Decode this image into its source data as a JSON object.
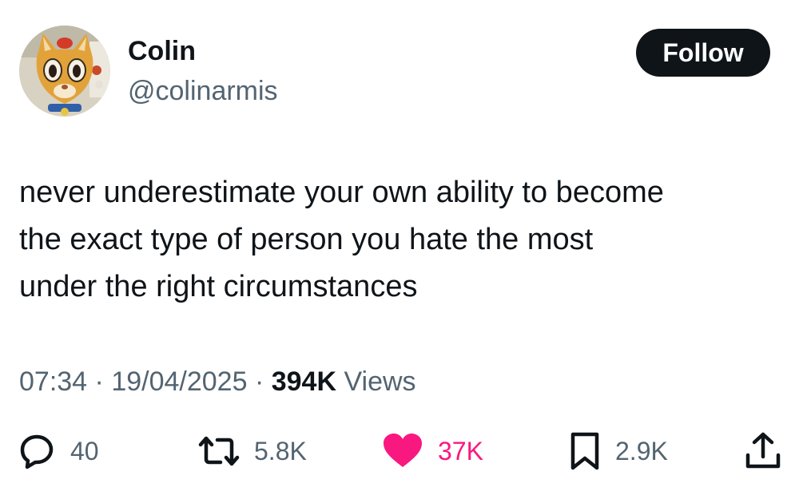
{
  "author": {
    "display_name": "Colin",
    "handle": "@colinarmis",
    "avatar_icon": "orange-cat-character-avatar"
  },
  "follow_button": {
    "label": "Follow"
  },
  "tweet": {
    "lines": [
      "never underestimate your own ability to become",
      "the exact type of person you hate the most",
      "under the right circumstances"
    ]
  },
  "meta": {
    "time": "07:34",
    "separator": "·",
    "date": "19/04/2025",
    "views_count": "394K",
    "views_label": "Views"
  },
  "actions": {
    "reply": {
      "icon": "reply-icon",
      "count": "40"
    },
    "repost": {
      "icon": "repost-icon",
      "count": "5.8K"
    },
    "like": {
      "icon": "heart-filled-icon",
      "count": "37K",
      "color": "#f91880"
    },
    "bookmark": {
      "icon": "bookmark-icon",
      "count": "2.9K"
    },
    "share": {
      "icon": "share-icon"
    }
  }
}
